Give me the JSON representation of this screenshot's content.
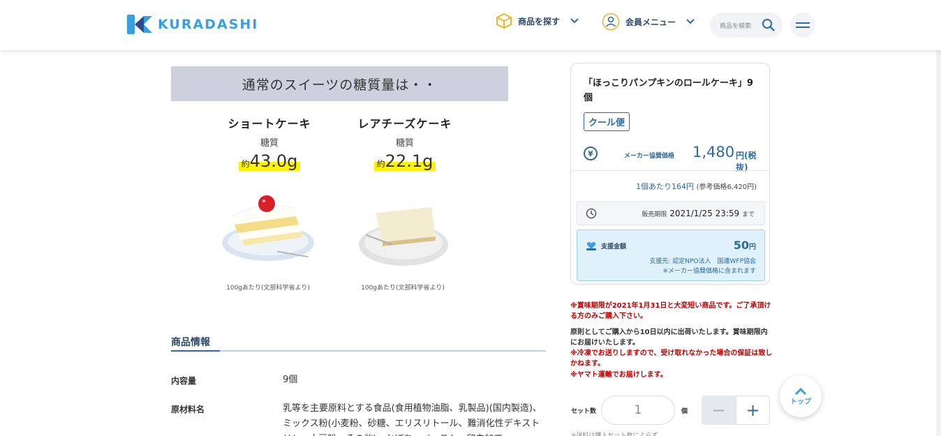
{
  "header": {
    "logo_text": "KURADASHI",
    "nav_search_items": "商品を探す",
    "nav_member_menu": "会員メニュー",
    "search_placeholder": "商品を検索"
  },
  "infographic": {
    "banner": "通常のスイーツの糖質量は・・",
    "cakes": [
      {
        "name": "ショートケーキ",
        "sub": "糖質",
        "prefix": "約",
        "value": "43.0g",
        "note": "100gあたり(文部科学省より)"
      },
      {
        "name": "レアチーズケーキ",
        "sub": "糖質",
        "prefix": "約",
        "value": "22.1g",
        "note": "100gあたり(文部科学省より)"
      }
    ]
  },
  "product_info": {
    "title": "商品情報",
    "rows": [
      {
        "label": "内容量",
        "value": "9個"
      },
      {
        "label": "原材料名",
        "value": "乳等を主要原料とする食品(食用植物油脂、乳製品)(国内製造)、ミックス粉(小麦粉、砂糖、エリスリトール、難消化性デキストリン、大豆粉、その他)、かぼちゃペースト、卵白加工"
      }
    ]
  },
  "card": {
    "title": "「ほっこりパンプキンのロールケーキ」9個",
    "badge": "クール便",
    "price_label": "メーカー協賛価格",
    "price": "1,480",
    "price_unit": "円(税抜)",
    "per_unit": "1個あたり164円",
    "ref_price": "(参考価格6,420円)",
    "deadline_label": "販売期限",
    "deadline": "2021/1/25 23:59",
    "deadline_tail": "まで",
    "support_label": "支援金額",
    "support_amount": "50",
    "support_unit": "円",
    "support_dest": "支援先: 認定NPO法人　国連WFP協会",
    "support_note": "※メーカー協賛価格に含まれます"
  },
  "notices": {
    "expiry": "※賞味期限が2021年1月31日と大変短い商品です。ご了承頂ける方のみご購入下さい。",
    "shipping": "原則としてご購入から10日以内に出荷いたします。賞味期限内にお届けいたします。",
    "frozen": "※冷凍でお送りしますので、受け取れなかった場合の保証は致しかねます。",
    "carrier": "※ヤマト運輸でお届けします。"
  },
  "purchase": {
    "set_label": "セット数",
    "qty": "1",
    "unit_label": "個",
    "minus": "−",
    "plus": "+",
    "shipping_note": "※送料は購入セット数によらず"
  },
  "top_button": {
    "arrow": "︿",
    "label": "トップ"
  },
  "colors": {
    "brand": "#3a9ee2",
    "accent": "#2c6aa0",
    "warning": "#c00000",
    "highlight": "#fff200"
  }
}
